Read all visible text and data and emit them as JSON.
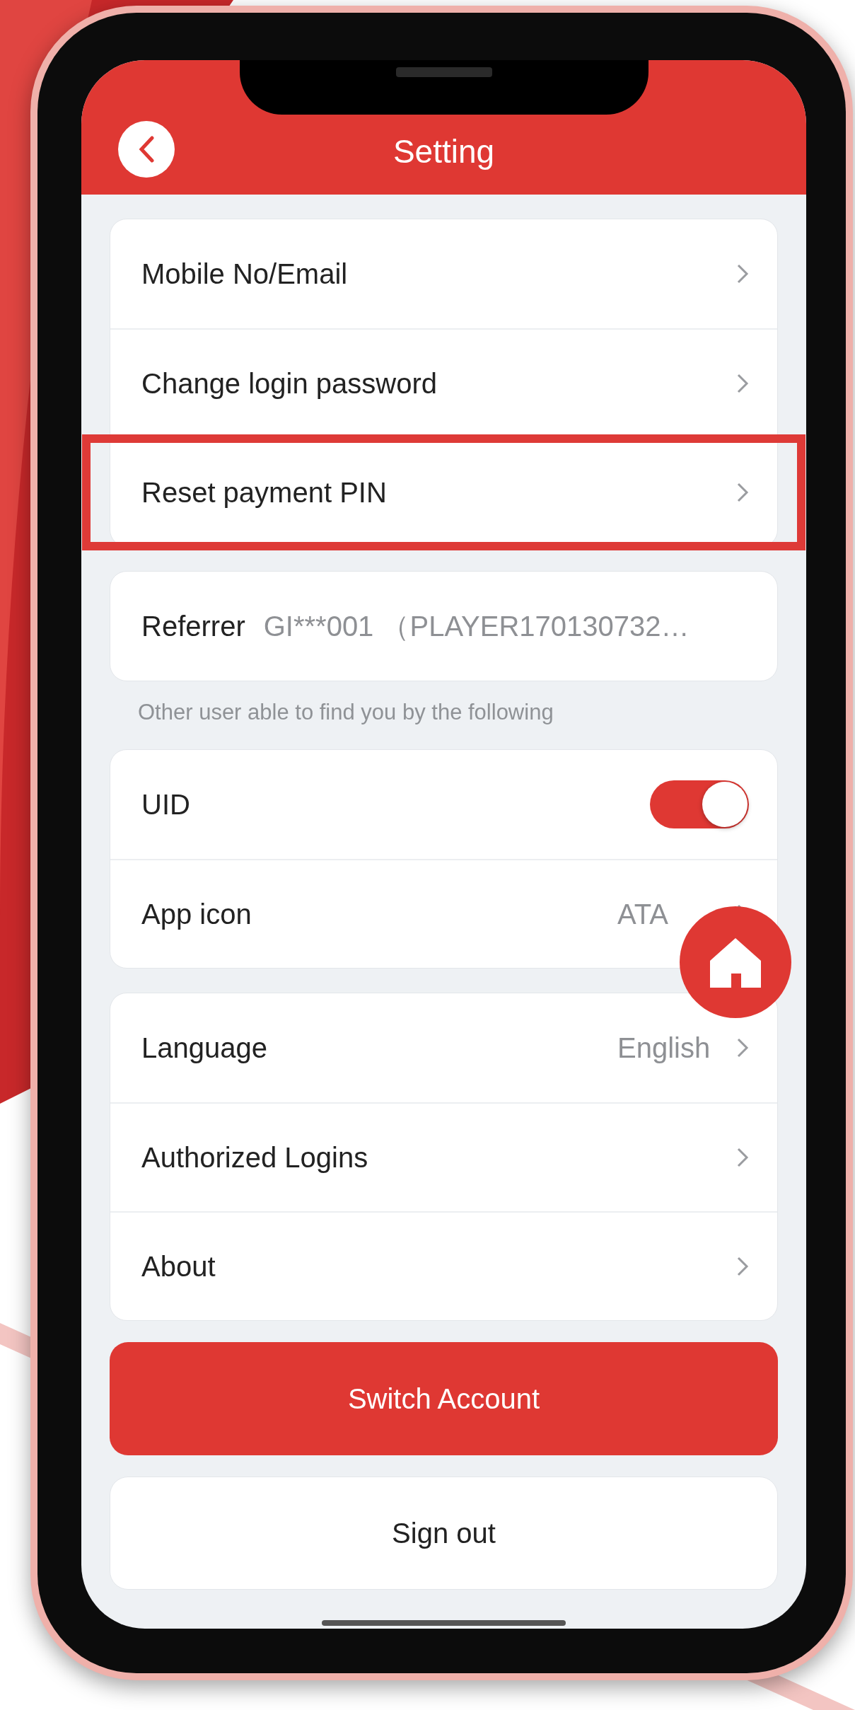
{
  "header": {
    "title": "Setting"
  },
  "groups": [
    {
      "items": [
        {
          "kind": "link",
          "label": "Mobile No/Email",
          "highlighted": false
        },
        {
          "kind": "link",
          "label": "Change login password",
          "highlighted": false
        },
        {
          "kind": "link",
          "label": "Reset payment PIN",
          "highlighted": true
        }
      ]
    },
    {
      "items": [
        {
          "kind": "info",
          "label": "Referrer",
          "value": "GI***001  （PLAYER170130732…",
          "highlighted": false
        }
      ],
      "note": "Other user able to find you by the following"
    },
    {
      "items": [
        {
          "kind": "toggle",
          "label": "UID",
          "on": true,
          "highlighted": false
        },
        {
          "kind": "link",
          "label": "App icon",
          "value": "ATA",
          "highlighted": false
        }
      ]
    },
    {
      "items": [
        {
          "kind": "link",
          "label": "Language",
          "value": "English",
          "highlighted": false
        },
        {
          "kind": "link",
          "label": "Authorized Logins",
          "highlighted": false
        },
        {
          "kind": "link",
          "label": "About",
          "highlighted": false
        }
      ]
    }
  ],
  "buttons": [
    {
      "kind": "primary",
      "label": "Switch Account"
    },
    {
      "kind": "secondary",
      "label": "Sign out"
    }
  ]
}
